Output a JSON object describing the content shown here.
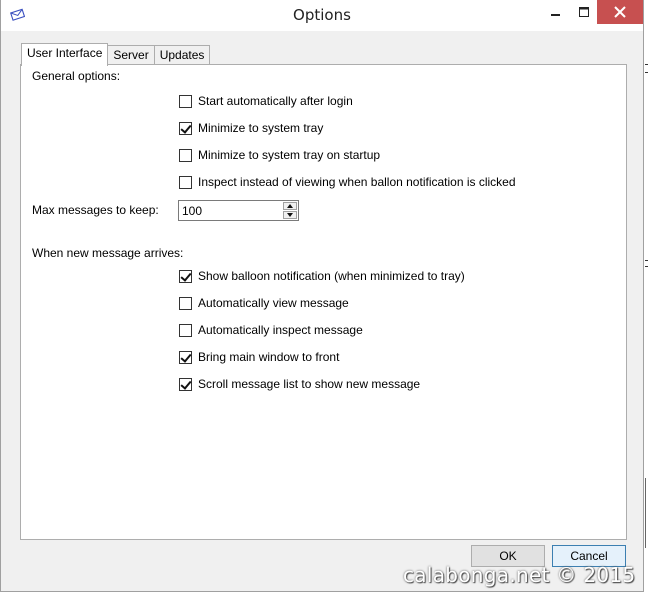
{
  "window": {
    "title": "Options"
  },
  "tabs": [
    {
      "label": "User Interface",
      "active": true
    },
    {
      "label": "Server",
      "active": false
    },
    {
      "label": "Updates",
      "active": false
    }
  ],
  "general": {
    "heading": "General options:",
    "options": [
      {
        "label": "Start automatically after login",
        "checked": false
      },
      {
        "label": "Minimize to system tray",
        "checked": true
      },
      {
        "label": "Minimize to system tray on startup",
        "checked": false
      },
      {
        "label": "Inspect instead of viewing when ballon notification is clicked",
        "checked": false
      }
    ]
  },
  "max_messages": {
    "label": "Max messages to keep:",
    "value": "100"
  },
  "new_message": {
    "heading": "When new message arrives:",
    "options": [
      {
        "label": "Show balloon notification (when minimized to tray)",
        "checked": true
      },
      {
        "label": "Automatically view message",
        "checked": false
      },
      {
        "label": "Automatically inspect message",
        "checked": false
      },
      {
        "label": "Bring main window to front",
        "checked": true
      },
      {
        "label": "Scroll message list to show new message",
        "checked": true
      }
    ]
  },
  "buttons": {
    "ok": "OK",
    "cancel": "Cancel"
  },
  "watermark": "calabonga.net © 2015",
  "icons": {
    "app": "envelope-icon",
    "minimize": "minimize-icon",
    "maximize": "maximize-icon",
    "close": "close-icon"
  },
  "colors": {
    "close_button": "#c75050",
    "default_button_border": "#3c7fb1"
  }
}
